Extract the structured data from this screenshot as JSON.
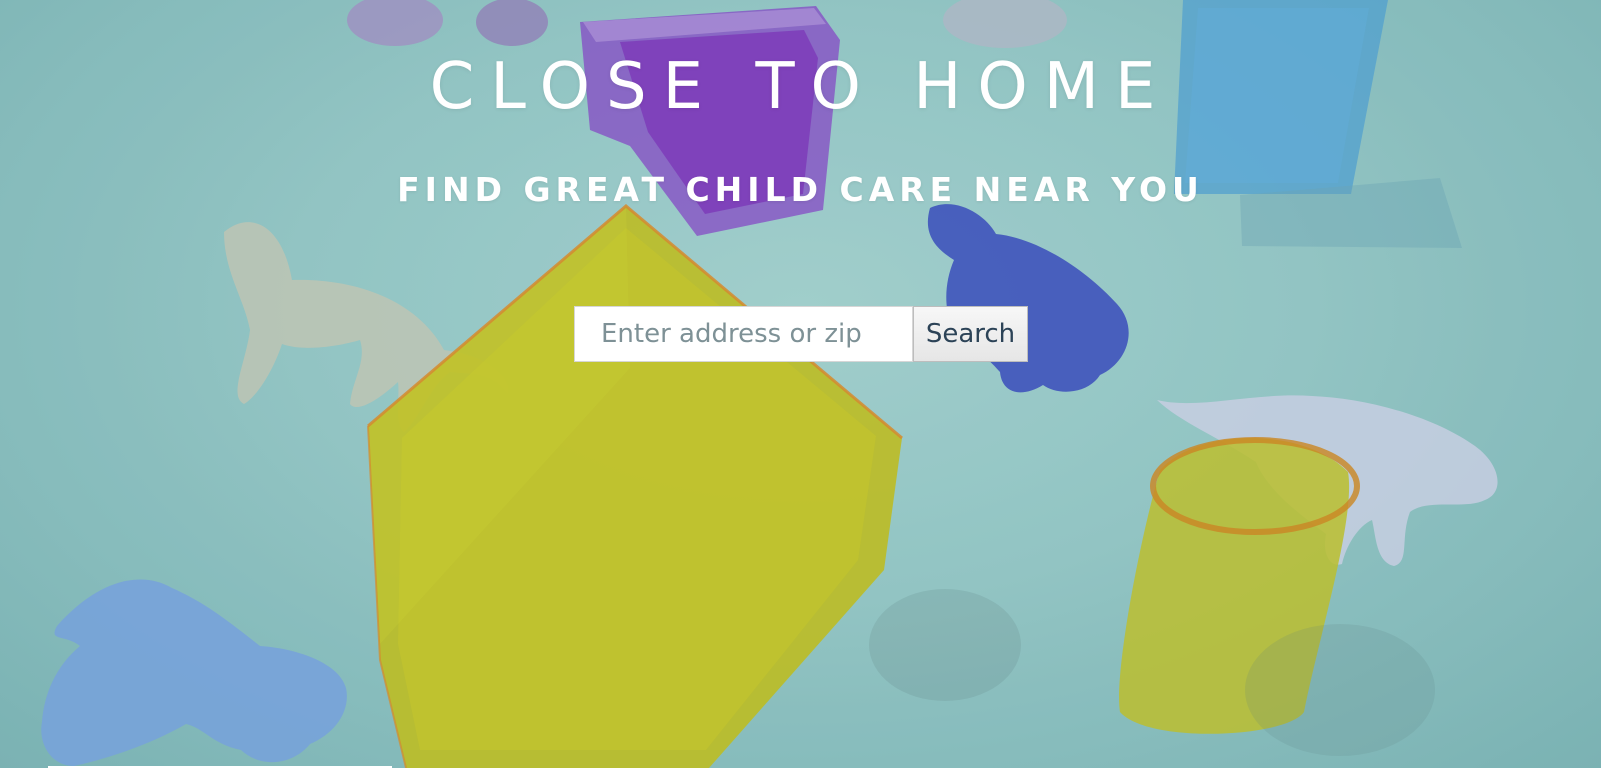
{
  "hero": {
    "title": "CLOSE TO HOME",
    "subtitle": "FIND GREAT CHILD CARE NEAR YOU"
  },
  "search": {
    "placeholder": "Enter address or zip",
    "value": "",
    "button_label": "Search"
  },
  "colors": {
    "background": "#98c8c6",
    "heading_text": "#ffffff",
    "button_text": "#2c4357",
    "input_placeholder": "#7e9196"
  },
  "icons": {
    "hero_background": "toy-animals-and-cubes-photo"
  }
}
